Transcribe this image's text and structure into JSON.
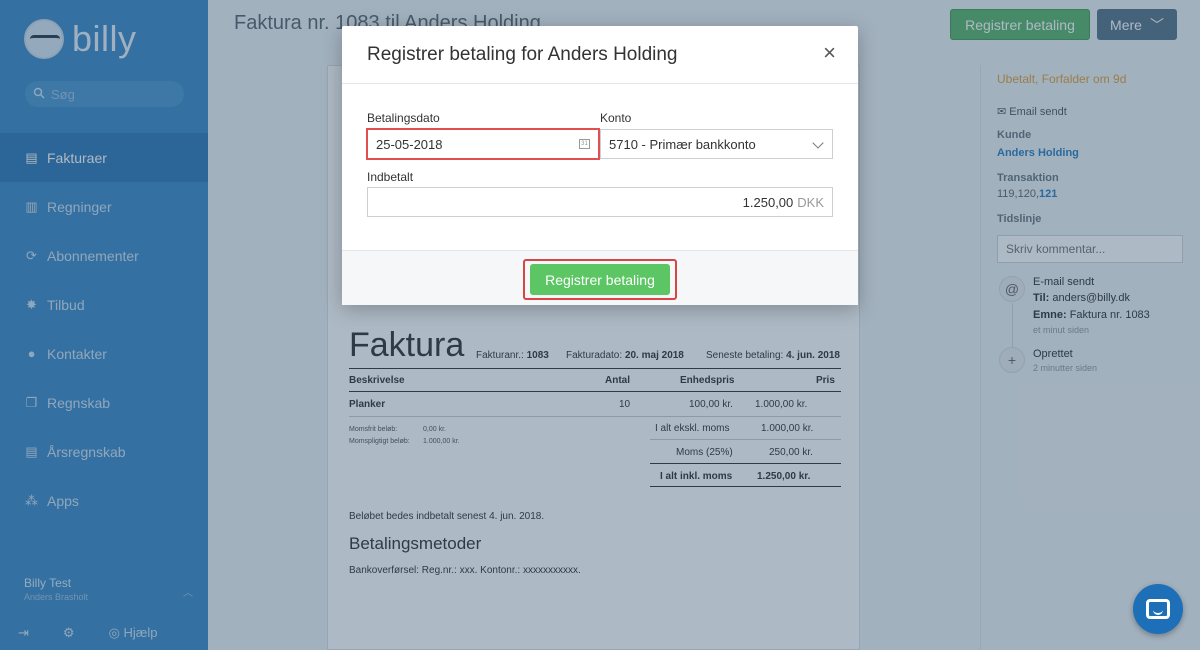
{
  "app": {
    "logo_text": "billy",
    "search_placeholder": "Søg"
  },
  "sidebar": {
    "items": [
      {
        "label": "Fakturaer",
        "icon": "invoice-icon",
        "active": true
      },
      {
        "label": "Regninger",
        "icon": "bills-icon",
        "active": false
      },
      {
        "label": "Abonnementer",
        "icon": "subscriptions-icon",
        "active": false
      },
      {
        "label": "Tilbud",
        "icon": "quotes-icon",
        "active": false
      },
      {
        "label": "Kontakter",
        "icon": "contacts-icon",
        "active": false
      },
      {
        "label": "Regnskab",
        "icon": "accounting-icon",
        "active": false
      },
      {
        "label": "Årsregnskab",
        "icon": "annual-report-icon",
        "active": false
      },
      {
        "label": "Apps",
        "icon": "apps-icon",
        "active": false
      }
    ],
    "user_name": "Billy Test",
    "user_company": "Anders Brasholt",
    "help_label": "Hjælp"
  },
  "header": {
    "title": "Faktura nr. 1083 til Anders Holding",
    "register_payment_label": "Registrer betaling",
    "more_label": "Mere"
  },
  "invoice": {
    "heading": "Faktura",
    "number_label": "Fakturanr.:",
    "number": "1083",
    "date_label": "Fakturadato:",
    "date": "20. maj 2018",
    "due_label": "Seneste betaling:",
    "due": "4. jun. 2018",
    "columns": [
      "Beskrivelse",
      "Antal",
      "Enhedspris",
      "Pris"
    ],
    "lines": [
      {
        "description": "Planker",
        "qty": "10",
        "unit_price": "100,00 kr.",
        "price": "1.000,00 kr."
      }
    ],
    "vatfree_label": "Momsfrit beløb:",
    "vatfree_value": "0,00 kr.",
    "vatable_label": "Momspligtigt beløb:",
    "vatable_value": "1.000,00 kr.",
    "subtotal_label": "I alt ekskl. moms",
    "subtotal": "1.000,00 kr.",
    "vat_label": "Moms (25%)",
    "vat": "250,00 kr.",
    "total_label": "I alt inkl. moms",
    "total": "1.250,00 kr.",
    "pay_note": "Beløbet bedes indbetalt senest 4. jun. 2018.",
    "payment_methods_heading": "Betalingsmetoder",
    "payment_methods_text": "Bankoverførsel: Reg.nr.: xxx. Kontonr.: xxxxxxxxxxx."
  },
  "right_panel": {
    "status": "Ubetalt, Forfalder om 9d",
    "email_sent": "Email sendt",
    "customer_label": "Kunde",
    "customer": "Anders Holding",
    "transaction_label": "Transaktion",
    "transaction_prefix": "119,120,",
    "transaction_link": "121",
    "timeline_label": "Tidslinje",
    "comment_placeholder": "Skriv kommentar...",
    "timeline": [
      {
        "title": "E-mail sendt",
        "to_label": "Til:",
        "to": "anders@billy.dk",
        "subject_label": "Emne:",
        "subject": "Faktura nr. 1083",
        "time": "et minut siden",
        "icon": "at-icon"
      },
      {
        "title": "Oprettet",
        "time": "2 minutter siden",
        "icon": "plus-icon"
      }
    ]
  },
  "modal": {
    "title": "Registrer betaling for Anders Holding",
    "date_label": "Betalingsdato",
    "date_value": "25-05-2018",
    "account_label": "Konto",
    "account_value": "5710 - Primær bankkonto",
    "amount_label": "Indbetalt",
    "amount_value": "1.250,00",
    "currency": "DKK",
    "submit_label": "Registrer betaling"
  },
  "colors": {
    "sidebar": "#3d89c7",
    "accent_green": "#5cc564",
    "highlight_red": "#d94444",
    "status_orange": "#e0a03c"
  }
}
